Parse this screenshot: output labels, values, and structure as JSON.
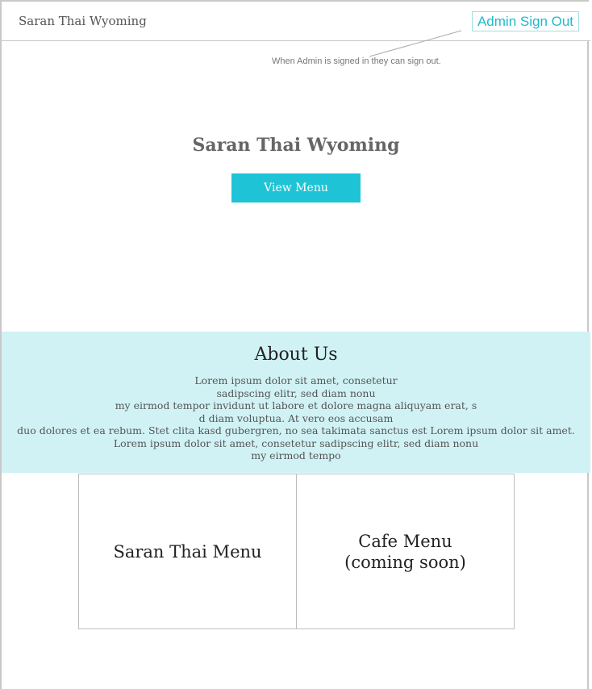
{
  "header": {
    "site_name": "Saran Thai Wyoming",
    "admin_button": "Admin Sign Out"
  },
  "annotation": {
    "text": "When Admin is signed in they can sign out."
  },
  "hero": {
    "title": "Saran Thai Wyoming",
    "button": "View Menu"
  },
  "about": {
    "title": "About Us",
    "lines": [
      "Lorem ipsum dolor sit amet, consetetur",
      "sadipscing elitr, sed diam nonu",
      "my eirmod tempor invidunt ut labore et dolore magna aliquyam erat, s",
      "d diam voluptua. At vero eos accusam",
      "duo dolores et ea rebum. Stet clita kasd gubergren, no sea takimata sanctus est Lorem ipsum dolor sit amet.",
      "Lorem ipsum dolor sit amet, consetetur sadipscing elitr, sed diam nonu",
      "my eirmod tempo"
    ]
  },
  "cards": {
    "left": "Saran Thai Menu",
    "right_line1": "Cafe Menu",
    "right_line2": "(coming soon)"
  },
  "colors": {
    "accent": "#1ec4d6",
    "about_bg": "#d0f2f5"
  }
}
